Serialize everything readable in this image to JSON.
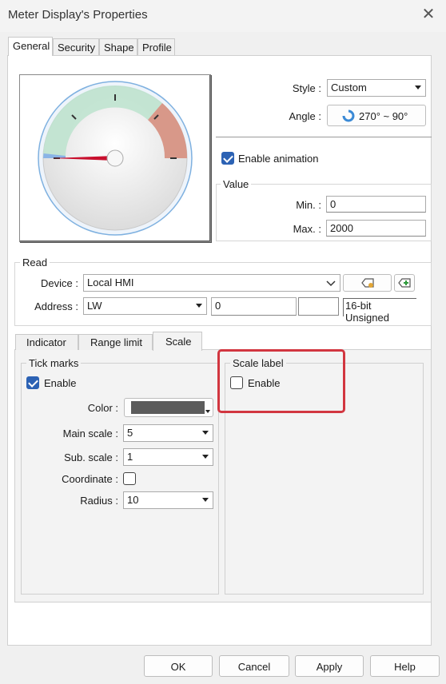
{
  "window": {
    "title": "Meter Display's Properties"
  },
  "tabs": [
    {
      "label": "General"
    },
    {
      "label": "Security"
    },
    {
      "label": "Shape"
    },
    {
      "label": "Profile"
    }
  ],
  "general": {
    "style_label": "Style :",
    "style_value": "Custom",
    "angle_label": "Angle :",
    "angle_value": "270° ~ 90°",
    "enable_animation": "Enable animation",
    "value_group": "Value",
    "min_label": "Min. :",
    "min_value": "0",
    "max_label": "Max. :",
    "max_value": "2000"
  },
  "read": {
    "group": "Read",
    "device_label": "Device :",
    "device_value": "Local HMI",
    "address_label": "Address :",
    "address_type": "LW",
    "address_value": "0",
    "data_type": "16-bit Unsigned"
  },
  "subtabs": [
    {
      "label": "Indicator"
    },
    {
      "label": "Range limit"
    },
    {
      "label": "Scale"
    }
  ],
  "scale": {
    "tick_group": "Tick marks",
    "tick_enable": "Enable",
    "color_label": "Color :",
    "color_value": "#5c5c5c",
    "main_scale_label": "Main scale :",
    "main_scale_value": "5",
    "sub_scale_label": "Sub. scale :",
    "sub_scale_value": "1",
    "coordinate_label": "Coordinate :",
    "radius_label": "Radius :",
    "radius_value": "10",
    "scale_label_group": "Scale label",
    "scale_label_enable": "Enable"
  },
  "buttons": {
    "ok": "OK",
    "cancel": "Cancel",
    "apply": "Apply",
    "help": "Help"
  }
}
